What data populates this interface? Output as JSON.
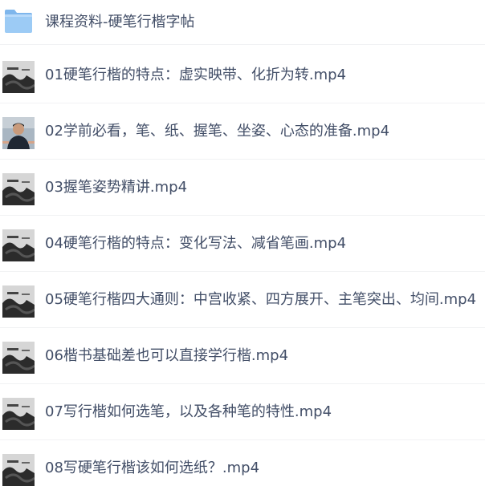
{
  "folder": {
    "name": "课程资料-硬笔行楷字帖",
    "icon": "folder-icon"
  },
  "files": [
    {
      "name": "01硬笔行楷的特点：虚实映带、化折为转.mp4",
      "thumbnail": "ink-painting-thumbnail"
    },
    {
      "name": "02学前必看，笔、纸、握笔、坐姿、心态的准备.mp4",
      "thumbnail": "presenter-thumbnail"
    },
    {
      "name": "03握笔姿势精讲.mp4",
      "thumbnail": "ink-painting-thumbnail"
    },
    {
      "name": "04硬笔行楷的特点：变化写法、减省笔画.mp4",
      "thumbnail": "ink-painting-thumbnail"
    },
    {
      "name": "05硬笔行楷四大通则：中宫收紧、四方展开、主笔突出、均间.mp4",
      "thumbnail": "ink-painting-thumbnail"
    },
    {
      "name": "06楷书基础差也可以直接学行楷.mp4",
      "thumbnail": "ink-painting-thumbnail"
    },
    {
      "name": "07写行楷如何选笔，以及各种笔的特性.mp4",
      "thumbnail": "ink-painting-thumbnail"
    },
    {
      "name": "08写硬笔行楷该如何选纸？.mp4",
      "thumbnail": "ink-painting-thumbnail"
    }
  ]
}
